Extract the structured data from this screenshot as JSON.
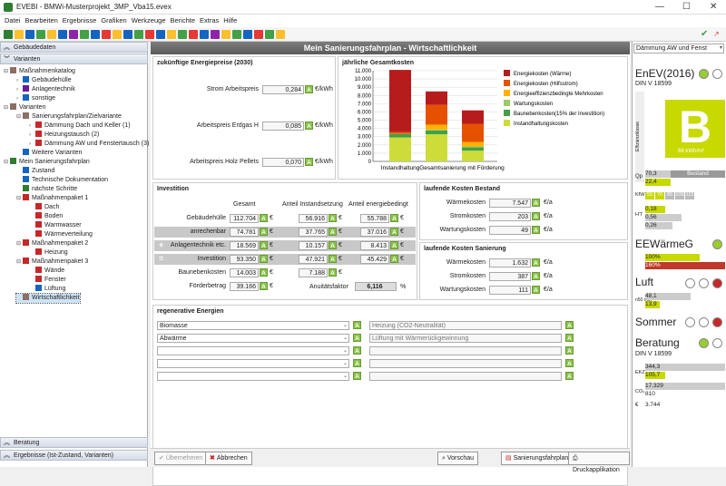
{
  "app": {
    "title": "EVEBI - BMWi-Musterprojekt_3MP_Vba15.evex"
  },
  "menu": [
    "Datei",
    "Bearbeiten",
    "Ergebnisse",
    "Grafiken",
    "Werkzeuge",
    "Berichte",
    "Extras",
    "Hilfe"
  ],
  "left": {
    "sec_gebaeude": "Gebäudedaten",
    "sec_varianten": "Varianten",
    "sec_beratung": "Beratung",
    "sec_ergebnisse": "Ergebnisse (Ist-Zustand, Varianten)",
    "tree": [
      {
        "label": "Maßnahmenkatalog",
        "x": 4,
        "y": 0,
        "exp": "⊟",
        "color": "#8d6e63"
      },
      {
        "label": "Gebäudehülle",
        "x": 18,
        "y": 10,
        "exp": "›",
        "color": "#1565c0"
      },
      {
        "label": "Anlagentechnik",
        "x": 18,
        "y": 20,
        "exp": "›",
        "color": "#6a1b9a"
      },
      {
        "label": "sonstige",
        "x": 18,
        "y": 30,
        "exp": "›",
        "color": "#1565c0"
      },
      {
        "label": "Varianten",
        "x": 4,
        "y": 40,
        "exp": "⊟",
        "color": "#8d6e63"
      },
      {
        "label": "Sanierungsfahrplan/Zielvariante",
        "x": 18,
        "y": 50,
        "exp": "⊟",
        "color": "#8d6e63"
      },
      {
        "label": "Dämmung Dach und Keller (1)",
        "x": 32,
        "y": 60,
        "exp": "›",
        "color": "#c62828"
      },
      {
        "label": "Heizungstausch (2)",
        "x": 32,
        "y": 70,
        "exp": "›",
        "color": "#c62828"
      },
      {
        "label": "Dämmung AW und Fenstertausch (3)",
        "x": 32,
        "y": 80,
        "exp": "›",
        "color": "#c62828"
      },
      {
        "label": "Weitere Varianten",
        "x": 18,
        "y": 90,
        "exp": "",
        "color": "#1565c0"
      },
      {
        "label": "Mein Sanierungsfahrplan",
        "x": 4,
        "y": 100,
        "exp": "⊟",
        "color": "#2e7d32"
      },
      {
        "label": "Zustand",
        "x": 18,
        "y": 110,
        "exp": "",
        "color": "#1565c0"
      },
      {
        "label": "Technische Dokumentation",
        "x": 18,
        "y": 120,
        "exp": "",
        "color": "#1565c0"
      },
      {
        "label": "nächste Schritte",
        "x": 18,
        "y": 130,
        "exp": "",
        "color": "#2e7d32"
      },
      {
        "label": "Maßnahmenpaket 1",
        "x": 18,
        "y": 140,
        "exp": "⊟",
        "color": "#c62828"
      },
      {
        "label": "Dach",
        "x": 32,
        "y": 150,
        "exp": "",
        "color": "#c62828"
      },
      {
        "label": "Boden",
        "x": 32,
        "y": 160,
        "exp": "",
        "color": "#c62828"
      },
      {
        "label": "Warmwasser",
        "x": 32,
        "y": 170,
        "exp": "",
        "color": "#c62828"
      },
      {
        "label": "Wärmeverteilung",
        "x": 32,
        "y": 180,
        "exp": "",
        "color": "#c62828"
      },
      {
        "label": "Maßnahmenpaket 2",
        "x": 18,
        "y": 190,
        "exp": "⊟",
        "color": "#c62828"
      },
      {
        "label": "Heizung",
        "x": 32,
        "y": 200,
        "exp": "",
        "color": "#c62828"
      },
      {
        "label": "Maßnahmenpaket 3",
        "x": 18,
        "y": 210,
        "exp": "⊟",
        "color": "#c62828"
      },
      {
        "label": "Wände",
        "x": 32,
        "y": 220,
        "exp": "",
        "color": "#c62828"
      },
      {
        "label": "Fenster",
        "x": 32,
        "y": 230,
        "exp": "",
        "color": "#c62828"
      },
      {
        "label": "Lüftung",
        "x": 32,
        "y": 240,
        "exp": "",
        "color": "#1565c0"
      },
      {
        "label": "Wirtschaftlichkeit",
        "x": 18,
        "y": 250,
        "exp": "",
        "color": "#8d6e63",
        "selected": true
      }
    ]
  },
  "main": {
    "title": "Mein Sanierungsfahrplan - Wirtschaftlichkeit",
    "prices": {
      "title": "zukünftige Energiepreise (2030)",
      "rows": [
        {
          "label": "Strom Arbeitspreis",
          "value": "0,284",
          "unit": "€/kWh"
        },
        {
          "label": "Arbeitspreis Erdgas H",
          "value": "0,085",
          "unit": "€/kWh"
        },
        {
          "label": "Arbeitspreis Holz Pellets",
          "value": "0,070",
          "unit": "€/kWh"
        }
      ]
    },
    "chart": {
      "title": "jährliche Gesamtkosten"
    },
    "invest": {
      "title": "Investition",
      "col1": "Gesamt",
      "col2": "Anteil Instandsetzung",
      "col3": "Anteil energiebedingt",
      "rows": [
        {
          "label": "Gebäudehülle",
          "v1": "112.704",
          "v2": "56.916",
          "v3": "55.788",
          "gray": false,
          "sym": ""
        },
        {
          "label": "anrechenbar",
          "v1": "74.781",
          "v2": "37.765",
          "v3": "37.016",
          "gray": true,
          "sym": ""
        },
        {
          "label": "Anlagentechnik etc.",
          "v1": "18.569",
          "v2": "10.157",
          "v3": "8.413",
          "gray": true,
          "sym": "+"
        },
        {
          "label": "Investition",
          "v1": "93.350",
          "v2": "47.921",
          "v3": "45.429",
          "gray": true,
          "sym": "="
        },
        {
          "label": "Baunebenkosten",
          "v1": "14.003",
          "v2": "7.188",
          "v3": "",
          "gray": false,
          "sym": ""
        },
        {
          "label": "Förderbetrag",
          "v1": "39.166",
          "v2": "",
          "v3": "",
          "gray": false,
          "sym": ""
        }
      ],
      "annuity_label": "Anuitätsfaktor",
      "annuity": "6,116",
      "unit_eur": "€",
      "unit_pct": "%"
    },
    "run_bestand": {
      "title": "laufende Kosten Bestand",
      "rows": [
        {
          "label": "Wärmekosten",
          "value": "7.547",
          "unit": "€/a"
        },
        {
          "label": "Stromkosten",
          "value": "203",
          "unit": "€/a"
        },
        {
          "label": "Wartungskosten",
          "value": "49",
          "unit": "€/a"
        }
      ]
    },
    "run_sanierung": {
      "title": "laufende Kosten Sanierung",
      "rows": [
        {
          "label": "Wärmekosten",
          "value": "1.632",
          "unit": "€/a"
        },
        {
          "label": "Stromkosten",
          "value": "387",
          "unit": "€/a"
        },
        {
          "label": "Wartungskosten",
          "value": "111",
          "unit": "€/a"
        }
      ]
    },
    "renew": {
      "title": "regenerative Energien",
      "rows": [
        {
          "sel": "Biomasse",
          "desc": "Heizung (CO2-Neutralität)"
        },
        {
          "sel": "Abwärme",
          "desc": "Lüftung mit Wärmerückgewinnung"
        },
        {
          "sel": "",
          "desc": ""
        },
        {
          "sel": "",
          "desc": ""
        },
        {
          "sel": "",
          "desc": ""
        }
      ]
    },
    "buttons": {
      "uebernehmen": "Übernehmen",
      "abbrechen": "Abbrechen",
      "vorschau": "Vorschau",
      "sanierungsfahrplan": "Sanierungsfahrplan",
      "druck": "Druckapplikation"
    }
  },
  "right": {
    "dropdown": "Dämmung AW und Fenst",
    "enev": {
      "title": "EnEV(2016)",
      "din": "DIN V 18599",
      "letter": "B",
      "klasse_label": "Effizienzklasse",
      "value": "68",
      "unit": "kWh/m²",
      "qp_label": "Qp",
      "qp1": "70,3",
      "qp2": "22,4",
      "bestand": "Bestand",
      "kfw_label": "KfW",
      "kfw": [
        "55",
        "70",
        "85",
        "100",
        "115"
      ],
      "ht_label": "H'T",
      "ht1": "0,18",
      "ht2": "0,56",
      "ht3": "0,26"
    },
    "ewg": {
      "title": "EEWärmeG",
      "v1": "100%",
      "v2": "160%"
    },
    "luft": {
      "title": "Luft",
      "label": "n50 min",
      "v1": "48,1",
      "v2": "13,9"
    },
    "sommer": {
      "title": "Sommer"
    },
    "beratung": {
      "title": "Beratung",
      "din": "DIN V 18599",
      "ekz": "EKZ",
      "ekz1": "344,3",
      "ekz2": "105,7",
      "co2": "CO₂",
      "co21": "17.329",
      "co22": "810",
      "eur": "€",
      "eur1": "3.744"
    }
  },
  "chart_data": {
    "type": "bar",
    "title": "jährliche Gesamtkosten",
    "categories": [
      "Instandhaltung",
      "Gesamtsanierung mit Förderung"
    ],
    "ylim": [
      0,
      11000
    ],
    "yticks": [
      "0",
      "1.000",
      "2.000",
      "3.000",
      "4.000",
      "5.000",
      "6.000",
      "7.000",
      "8.000",
      "9.000",
      "10.000",
      "11.000"
    ],
    "series": [
      {
        "name": "Energiekosten (Wärme)",
        "color": "#b71c1c",
        "values": [
          7550,
          1630,
          1630
        ]
      },
      {
        "name": "Energiekosten (Hilfsstrom)",
        "color": "#e65100",
        "values": [
          200,
          2400,
          2200
        ]
      },
      {
        "name": "Energieeffizienzbedingte Mehrkosten",
        "color": "#ffb300",
        "values": [
          0,
          600,
          550
        ]
      },
      {
        "name": "Wartungskosten",
        "color": "#9ccc65",
        "values": [
          50,
          110,
          110
        ]
      },
      {
        "name": "Baunebenkosten(15% der Investition)",
        "color": "#43a047",
        "values": [
          400,
          450,
          400
        ]
      },
      {
        "name": "Instandhaltungskosten",
        "color": "#cddc39",
        "values": [
          2900,
          3300,
          1300
        ]
      }
    ]
  }
}
